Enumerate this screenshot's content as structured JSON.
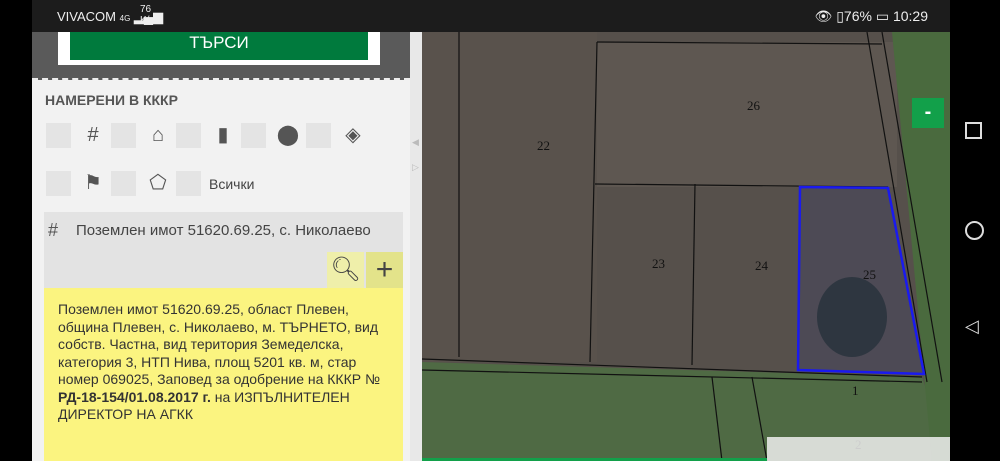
{
  "status_bar": {
    "carrier": "VIVACOM",
    "network": "4G",
    "speed_value": "76",
    "speed_unit": "K/s",
    "battery": "76%",
    "time": "10:29"
  },
  "search": {
    "button_label": "ТЪРСИ"
  },
  "found": {
    "heading": "НАМЕРЕНИ В КККР",
    "filter_all_label": "Всички"
  },
  "result": {
    "title": "Поземлен имот 51620.69.25, с. Николаево"
  },
  "info": {
    "text_1": "Поземлен имот 51620.69.25, област Плевен, община Плевен, с. Николаево, м. ТЪРНЕТО, вид собств. Частна, вид територия Земеделска, категория 3, НТП Нива, площ 5201 кв. м, стар номер 069025, Заповед за одобрение на КККР № ",
    "order_bold": "РД-18-154/01.08.2017 г.",
    "text_2": " на ИЗПЪЛНИТЕЛЕН ДИРЕКТОР НА АГКК"
  },
  "map": {
    "zoom_out_label": "-",
    "parcels": [
      "22",
      "26",
      "23",
      "24",
      "25",
      "1",
      "2"
    ],
    "selected_color": "#1a1aee"
  }
}
